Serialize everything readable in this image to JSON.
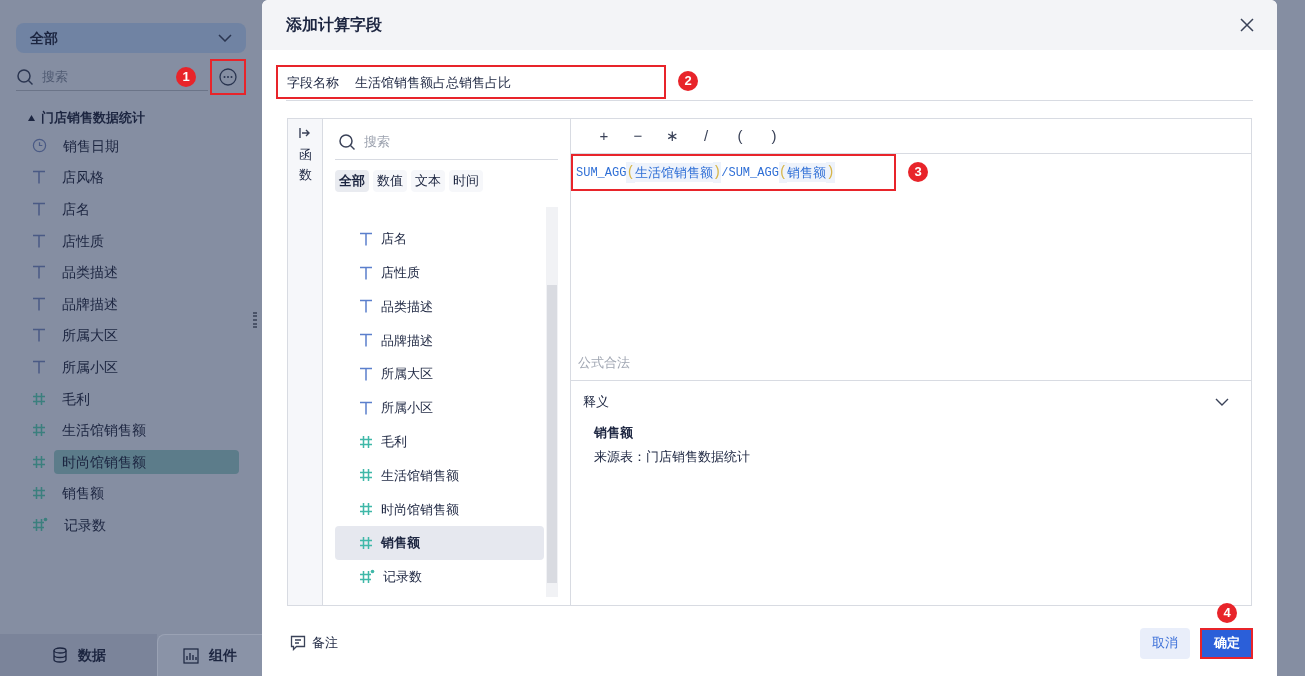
{
  "sidebar": {
    "dropdown": "全部",
    "search_placeholder": "搜索",
    "annotation": "1",
    "tree": {
      "label": "门店销售数据统计",
      "expanded": true,
      "children": [
        {
          "label": "销售日期",
          "kind": "date",
          "selected": false
        },
        {
          "label": "店风格",
          "kind": "text",
          "selected": false
        },
        {
          "label": "店名",
          "kind": "text",
          "selected": false
        },
        {
          "label": "店性质",
          "kind": "text",
          "selected": false
        },
        {
          "label": "品类描述",
          "kind": "text",
          "selected": false
        },
        {
          "label": "品牌描述",
          "kind": "text",
          "selected": false
        },
        {
          "label": "所属大区",
          "kind": "text",
          "selected": false
        },
        {
          "label": "所属小区",
          "kind": "text",
          "selected": false
        },
        {
          "label": "毛利",
          "kind": "number",
          "selected": false
        },
        {
          "label": "生活馆销售额",
          "kind": "number",
          "selected": false
        },
        {
          "label": "时尚馆销售额",
          "kind": "number",
          "selected": true
        },
        {
          "label": "销售额",
          "kind": "number",
          "selected": false
        },
        {
          "label": "记录数",
          "kind": "count",
          "selected": false
        }
      ]
    },
    "bottom_tabs": [
      {
        "label": "数据",
        "kind": "data",
        "selected": true
      },
      {
        "label": "组件",
        "kind": "chart",
        "selected": false
      }
    ]
  },
  "dialog": {
    "title": "添加计算字段",
    "field_name": {
      "label": "字段名称",
      "value": "生活馆销售额占总销售占比",
      "annotation": "2"
    },
    "function_tab": "函数",
    "field_search_placeholder": "搜索",
    "filters": [
      {
        "label": "全部",
        "selected": true
      },
      {
        "label": "数值",
        "selected": false
      },
      {
        "label": "文本",
        "selected": false
      },
      {
        "label": "时间",
        "selected": false
      }
    ],
    "fields": [
      {
        "label": "店名",
        "kind": "text",
        "selected": false
      },
      {
        "label": "店性质",
        "kind": "text",
        "selected": false
      },
      {
        "label": "品类描述",
        "kind": "text",
        "selected": false
      },
      {
        "label": "品牌描述",
        "kind": "text",
        "selected": false
      },
      {
        "label": "所属大区",
        "kind": "text",
        "selected": false
      },
      {
        "label": "所属小区",
        "kind": "text",
        "selected": false
      },
      {
        "label": "毛利",
        "kind": "number",
        "selected": false
      },
      {
        "label": "生活馆销售额",
        "kind": "number",
        "selected": false
      },
      {
        "label": "时尚馆销售额",
        "kind": "number",
        "selected": false
      },
      {
        "label": "销售额",
        "kind": "number",
        "selected": true
      },
      {
        "label": "记录数",
        "kind": "count",
        "selected": false
      }
    ],
    "operators": [
      "+",
      "−",
      "∗",
      "/",
      "(",
      ")"
    ],
    "formula": [
      {
        "kind": "func",
        "text": "SUM_AGG"
      },
      {
        "kind": "paren",
        "text": "("
      },
      {
        "kind": "field",
        "text": "生活馆销售额"
      },
      {
        "kind": "paren",
        "text": ")"
      },
      {
        "kind": "op",
        "text": "/"
      },
      {
        "kind": "func",
        "text": "SUM_AGG"
      },
      {
        "kind": "paren",
        "text": "("
      },
      {
        "kind": "field",
        "text": "销售额"
      },
      {
        "kind": "paren",
        "text": ")"
      }
    ],
    "formula_annotation": "3",
    "status": "公式合法",
    "explain": {
      "title": "释义",
      "expanded": true,
      "name": "销售额",
      "source": "来源表：门店销售数据统计"
    },
    "note": "备注",
    "cancel": "取消",
    "confirm": "确定",
    "confirm_annotation": "4"
  }
}
